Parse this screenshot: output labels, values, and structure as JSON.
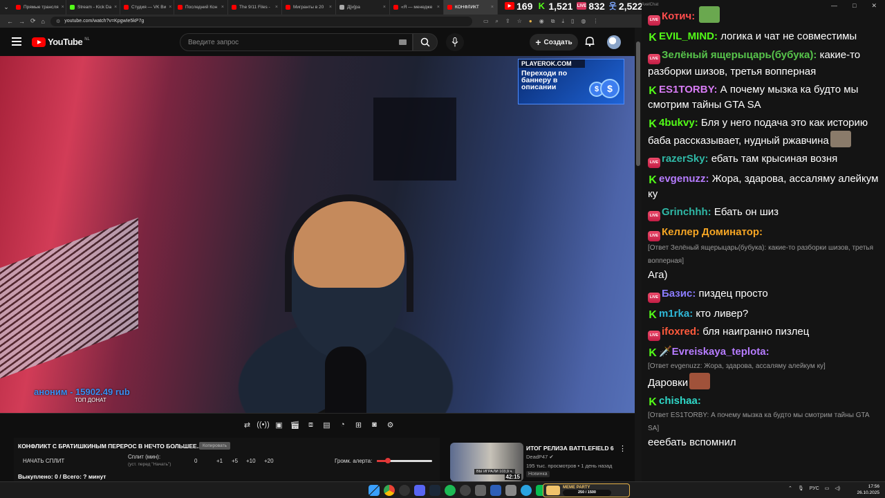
{
  "browser": {
    "tabs": [
      {
        "label": "Прямые трансля",
        "color": "#ff0000"
      },
      {
        "label": "Stream - Kick Da",
        "color": "#53fc18"
      },
      {
        "label": "Студия — VK Ви",
        "color": "#ff0000"
      },
      {
        "label": "Последний Кон",
        "color": "#ff0000"
      },
      {
        "label": "The 9/11 Files -",
        "color": "#ff0000"
      },
      {
        "label": "Мигранты в 20",
        "color": "#ff0000"
      },
      {
        "label": "Д[и]ра",
        "color": "#aaaaaa"
      },
      {
        "label": "«Я — менедже",
        "color": "#ff0000"
      },
      {
        "label": "КОНФЛИКТ",
        "color": "#ff0000"
      }
    ],
    "url": "youtube.com/watch?v=KpgwIe5kP7g"
  },
  "counters": {
    "youtube": "169",
    "kick": "1,521",
    "live": "832",
    "total": "2,522"
  },
  "youtube": {
    "logo": "YouTube",
    "country": "NL",
    "search_placeholder": "Введите запрос",
    "create_label": "Создать"
  },
  "video": {
    "ad_top": "PLAYEROK.COM",
    "ad_text": "Переходи по баннеру в описании",
    "ad_coin": "$",
    "donate_line": "аноним - 15902.49 rub",
    "donate_label": "ТОП ДОНАТ"
  },
  "panel": {
    "title": "КОНФЛИКТ С БРАТИШКИНЫМ ПЕРЕРОС В НЕЧТО БОЛЬШЕЕ...",
    "copy_label": "Копировать",
    "split_button": "НАЧАТЬ СПЛИТ",
    "split_label": "Сплит (мин):",
    "split_hint": "(уст. перед \"Начать\")",
    "split_values": [
      "0",
      "+1",
      "+5",
      "+10",
      "+20"
    ],
    "volume_label": "Громк. алерта:",
    "volume_level": 0.2,
    "bought": "Выкуплено: 0 / Всего: ? минут"
  },
  "recommended": {
    "title": "ИТОГ РЕЛИЗА BATTLEFIELD 6",
    "channel": "DeadP47",
    "meta": "195 тыс. просмотров • 1 день назад",
    "badge": "Новинка",
    "duration": "42:15",
    "thumb_label": "ВЫ ИГРАЛИ 103,9 ч."
  },
  "chat": {
    "tab_title": "AxelChat",
    "messages": [
      {
        "platform": "yt",
        "user": "Котич:",
        "color": "#ff4d4d",
        "text": "",
        "reply": "",
        "emote": true
      },
      {
        "platform": "kick",
        "user": "EVIL_MIND:",
        "color": "#53fc18",
        "text": "логика и чат не совместимы",
        "reply": ""
      },
      {
        "platform": "yt",
        "user": "Зелёный ящерыцарь(бубука):",
        "color": "#57c44b",
        "text": "какие-то разборки шизов, третья вопперная",
        "reply": ""
      },
      {
        "platform": "kick",
        "user": "ES1TORBY:",
        "color": "#d87cf5",
        "text": "А почему мызка ка будто мы смотрим тайны GTA SA",
        "reply": ""
      },
      {
        "platform": "kick",
        "user": "4bukvy:",
        "color": "#53fc18",
        "text": "Бля у него подача это как историю баба рассказывает, нудный ржавчина",
        "reply": "",
        "emote": true
      },
      {
        "platform": "yt",
        "user": "razerSky:",
        "color": "#2fb8a6",
        "text": "ебать там крысиная возня",
        "reply": ""
      },
      {
        "platform": "kick",
        "user": "evgenuzz:",
        "color": "#b67cff",
        "text": "Жора, здарова, ассаляму алейкум ку",
        "reply": ""
      },
      {
        "platform": "yt",
        "user": "Grinchhh:",
        "color": "#2fb8a6",
        "text": "Ебать он шиз",
        "reply": ""
      },
      {
        "platform": "yt",
        "user": "Келлер Доминатор:",
        "color": "#f5a524",
        "text": "Ага)",
        "reply": "[Ответ Зелёный ящерыцарь(бубука): какие-то разборки шизов, третья вопперная]"
      },
      {
        "platform": "yt",
        "user": "Базис:",
        "color": "#8b7cff",
        "text": "пиздец просто",
        "reply": ""
      },
      {
        "platform": "kick",
        "user": "m1rka:",
        "color": "#2fb8d8",
        "text": "кто ливер?",
        "reply": ""
      },
      {
        "platform": "yt",
        "user": "ifoxred:",
        "color": "#ff5a3c",
        "text": "бля наигранно пизлец",
        "reply": ""
      },
      {
        "platform": "kick",
        "user": "🗡️Evreiskaya_teplota:",
        "color": "#b67cff",
        "text": "Даровки",
        "reply": "[Ответ evgenuzz: Жора, здарова, ассаляму алейкум ку]",
        "emote": true
      },
      {
        "platform": "kick",
        "user": "chishaa:",
        "color": "#2fd8c8",
        "text": "еeeбать вспомнил",
        "reply": "[Ответ ES1TORBY: А почему мызка ка будто мы смотрим тайны GTA SA]"
      }
    ]
  },
  "taskbar": {
    "meme_title": "MEME PARTY",
    "meme_progress": "250 / 1500",
    "lang": "РУС",
    "time": "17:56",
    "date": "26.10.2025"
  }
}
